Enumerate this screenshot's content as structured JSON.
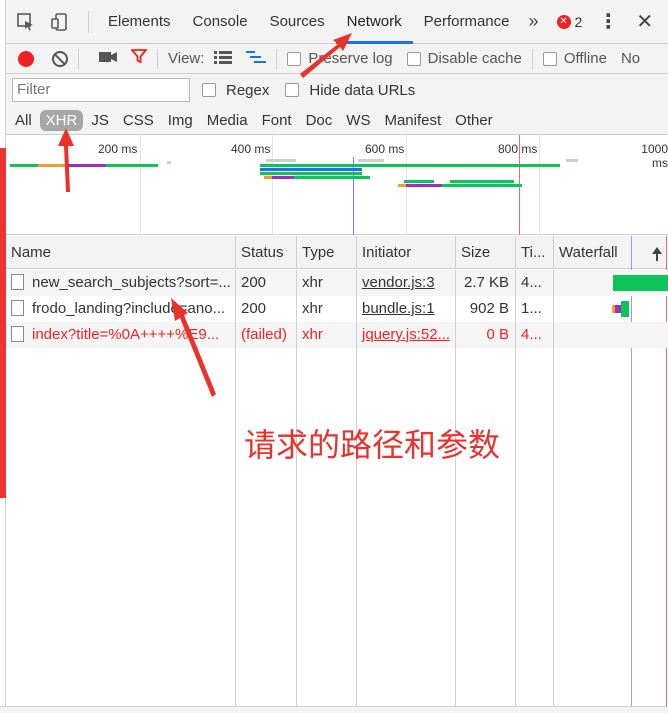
{
  "tabs": {
    "items": [
      "Elements",
      "Console",
      "Sources",
      "Network",
      "Performance"
    ],
    "active": "Network",
    "more": "»",
    "error_count": "2",
    "kebab": "⋮",
    "close": "✕"
  },
  "toolbar": {
    "view_label": "View:",
    "preserve_log": "Preserve log",
    "disable_cache": "Disable cache",
    "offline": "Offline",
    "throttle": "No"
  },
  "filterbar": {
    "placeholder": "Filter",
    "regex": "Regex",
    "hide_data_urls": "Hide data URLs"
  },
  "types": {
    "items": [
      "All",
      "XHR",
      "JS",
      "CSS",
      "Img",
      "Media",
      "Font",
      "Doc",
      "WS",
      "Manifest",
      "Other"
    ],
    "active": "XHR"
  },
  "overview": {
    "ticks": [
      "200 ms",
      "400 ms",
      "600 ms",
      "800 ms",
      "1000 ms"
    ]
  },
  "table": {
    "headers": {
      "name": "Name",
      "status": "Status",
      "type": "Type",
      "initiator": "Initiator",
      "size": "Size",
      "time": "Ti...",
      "waterfall": "Waterfall"
    },
    "rows": [
      {
        "name": "new_search_subjects?sort=...",
        "status": "200",
        "type": "xhr",
        "initiator": "vendor.js:3",
        "size": "2.7 KB",
        "time": "4...",
        "failed": false
      },
      {
        "name": "frodo_landing?include=ano...",
        "status": "200",
        "type": "xhr",
        "initiator": "bundle.js:1",
        "size": "902 B",
        "time": "1...",
        "failed": false
      },
      {
        "name": "index?title=%0A++++%E9...",
        "status": "(failed)",
        "type": "xhr",
        "initiator": "jquery.js:52...",
        "size": "0 B",
        "time": "4...",
        "failed": true
      }
    ]
  },
  "annotation": {
    "text": "请求的路径和参数",
    "color": "#e8322b"
  },
  "colors": {
    "accent": "#1a73e8",
    "record": "#e22222",
    "failed": "#e22222",
    "waterfall_green": "#0cc45a",
    "waterfall_orange": "#f0a030",
    "waterfall_purple": "#9b30c0"
  }
}
